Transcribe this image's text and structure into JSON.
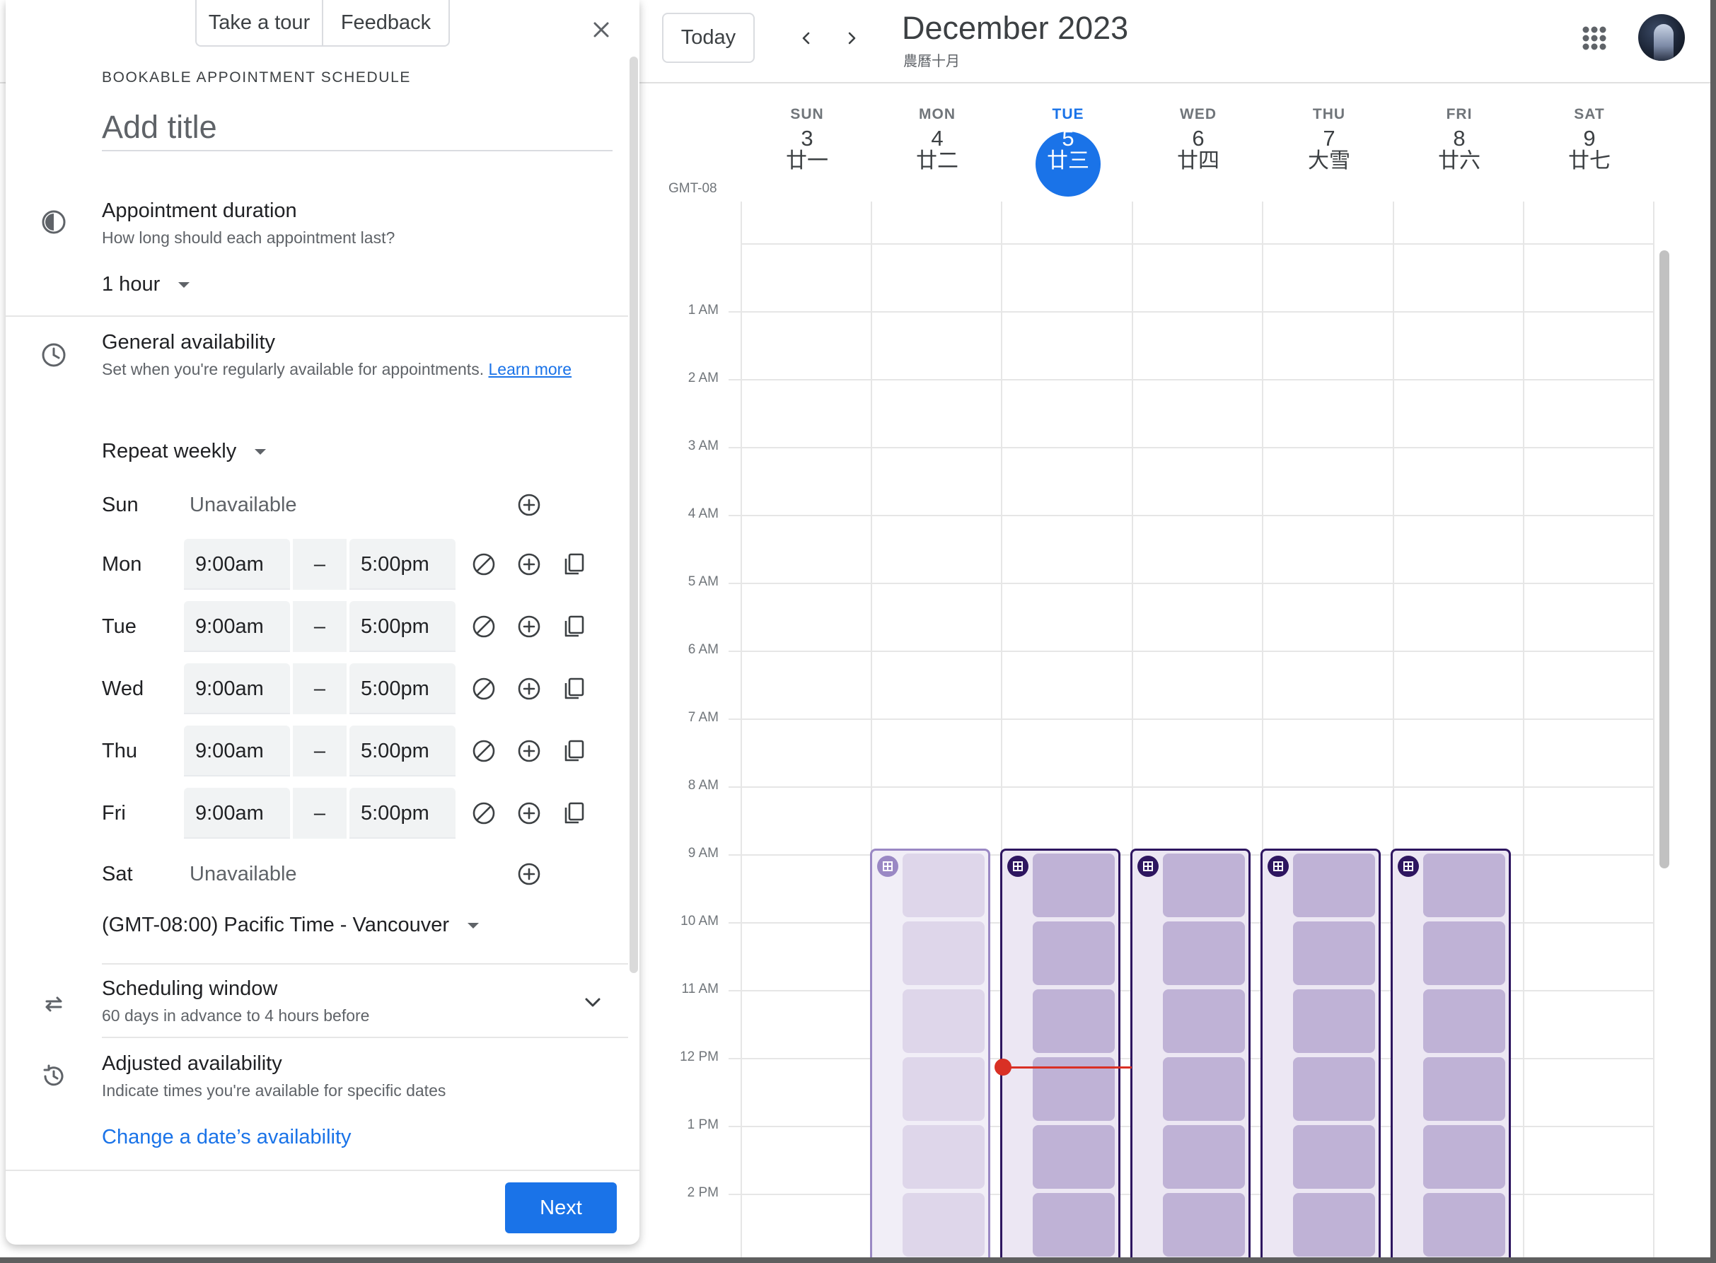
{
  "header": {
    "today_label": "Today",
    "month_title": "December 2023",
    "lunar_month": "農曆十月",
    "timezone_short": "GMT-08"
  },
  "days": [
    {
      "name": "SUN",
      "num": "3",
      "lunar": "廿一"
    },
    {
      "name": "MON",
      "num": "4",
      "lunar": "廿二"
    },
    {
      "name": "TUE",
      "num": "5",
      "lunar": "廿三"
    },
    {
      "name": "WED",
      "num": "6",
      "lunar": "廿四"
    },
    {
      "name": "THU",
      "num": "7",
      "lunar": "大雪"
    },
    {
      "name": "FRI",
      "num": "8",
      "lunar": "廿六"
    },
    {
      "name": "SAT",
      "num": "9",
      "lunar": "廿七"
    }
  ],
  "hours": [
    "1 AM",
    "2 AM",
    "3 AM",
    "4 AM",
    "5 AM",
    "6 AM",
    "7 AM",
    "8 AM",
    "9 AM",
    "10 AM",
    "11 AM",
    "12 PM",
    "1 PM",
    "2 PM"
  ],
  "panel": {
    "tour_label": "Take a tour",
    "feedback_label": "Feedback",
    "kicker": "BOOKABLE APPOINTMENT SCHEDULE",
    "title_placeholder": "Add title",
    "duration": {
      "title": "Appointment duration",
      "subtitle": "How long should each appointment last?",
      "value": "1 hour"
    },
    "availability": {
      "title": "General availability",
      "subtitle": "Set when you're regularly available for appointments.",
      "learn_more": "Learn more",
      "repeat": "Repeat weekly",
      "days": [
        {
          "label": "Sun",
          "unavailable": "Unavailable"
        },
        {
          "label": "Mon",
          "start": "9:00am",
          "sep": "–",
          "end": "5:00pm"
        },
        {
          "label": "Tue",
          "start": "9:00am",
          "sep": "–",
          "end": "5:00pm"
        },
        {
          "label": "Wed",
          "start": "9:00am",
          "sep": "–",
          "end": "5:00pm"
        },
        {
          "label": "Thu",
          "start": "9:00am",
          "sep": "–",
          "end": "5:00pm"
        },
        {
          "label": "Fri",
          "start": "9:00am",
          "sep": "–",
          "end": "5:00pm"
        },
        {
          "label": "Sat",
          "unavailable": "Unavailable"
        }
      ],
      "timezone": "(GMT-08:00) Pacific Time - Vancouver"
    },
    "scheduling_window": {
      "title": "Scheduling window",
      "subtitle": "60 days in advance to 4 hours before"
    },
    "adjusted": {
      "title": "Adjusted availability",
      "subtitle": "Indicate times you're available for specific dates",
      "link": "Change a date’s availability"
    },
    "next_label": "Next"
  },
  "colors": {
    "accent": "#1a73e8",
    "appointment_border": "#2e1660",
    "appointment_slot": "#bfb2d6",
    "now_line": "#d93025"
  }
}
